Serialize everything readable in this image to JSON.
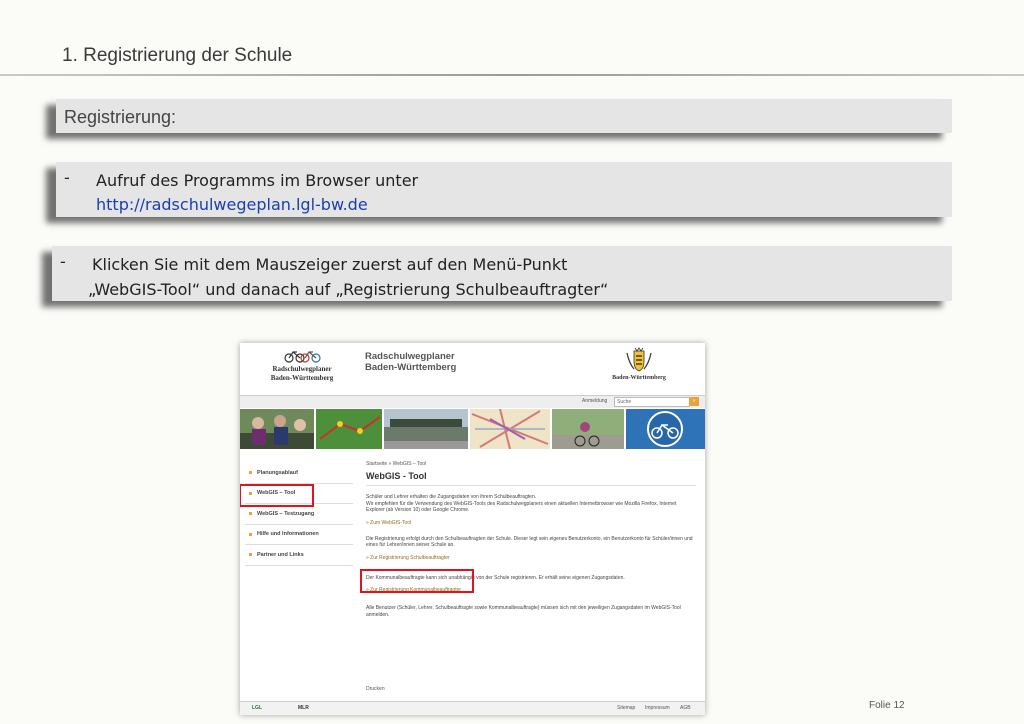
{
  "slide": {
    "title": "1. Registrierung der Schule",
    "heading": "Registrierung:",
    "bullet1_line1": "Aufruf des Programms im Browser unter",
    "bullet1_link": "http://radschulwegeplan.lgl-bw.de",
    "bullet2_line1": "Klicken Sie mit dem Mauszeiger zuerst auf den Menü-Punkt",
    "bullet2_line2": "„WebGIS-Tool“ und danach auf „Registrierung Schulbeauftragter“",
    "dash": "-",
    "footer": "Folie 12"
  },
  "website": {
    "logo_left_line1": "Radschulwegplaner",
    "logo_left_line2": "Baden-Württemberg",
    "site_title_line1": "Radschulwegplaner",
    "site_title_line2": "Baden-Württemberg",
    "logo_right": "Baden-Württemberg",
    "login_link": "Anmeldung",
    "search_placeholder": "Suche",
    "search_button": "»",
    "nav": [
      "Planungsablauf",
      "WebGIS – Tool",
      "WebGIS – Testzugang",
      "Hilfe und Informationen",
      "Partner und Links"
    ],
    "breadcrumb": "Startseite  »  WebGIS – Tool",
    "page_heading": "WebGIS - Tool",
    "para1": "Schüler und Lehrer erhalten die Zugangsdaten von ihrem Schulbeauftragten.",
    "para1b": "Wir empfehlen für die Verwendung des WebGIS-Tools des Radschulwegplaners einen aktuellen Internetbrowser wie Mozilla Firefox, Internet Explorer (ab Version 10) oder Google Chrome.",
    "link_webgis": "»  Zum WebGIS-Tool",
    "para2": "Die Registrierung erfolgt durch den Schulbeauftragten der Schule. Dieser legt sein eigenes Benutzerkonto, ein Benutzerkonto für Schüler/innen und eines für Lehrer/innen seiner Schule an.",
    "link_schulbeauftragter": "»  Zur Registrierung Schulbeauftragter",
    "para3": "Der Kommunalbeauftragte kann sich unabhängig von der Schule registrieren. Er erhält seine eigenen Zugangsdaten.",
    "link_kommunal": "»  Zur Registrierung Kommunalbeauftragter",
    "para4": "Alle Benutzer (Schüler, Lehrer, Schulbeauftragte sowie Kommunalbeauftragte) müssen sich mit den jeweiligen Zugangsdaten im WebGIS-Tool anmelden.",
    "drucken": "Drucken",
    "footer_logo1": "LGL",
    "footer_logo2": "MLR",
    "footer_links": [
      "Sitemap",
      "Impressum",
      "AGB"
    ]
  }
}
